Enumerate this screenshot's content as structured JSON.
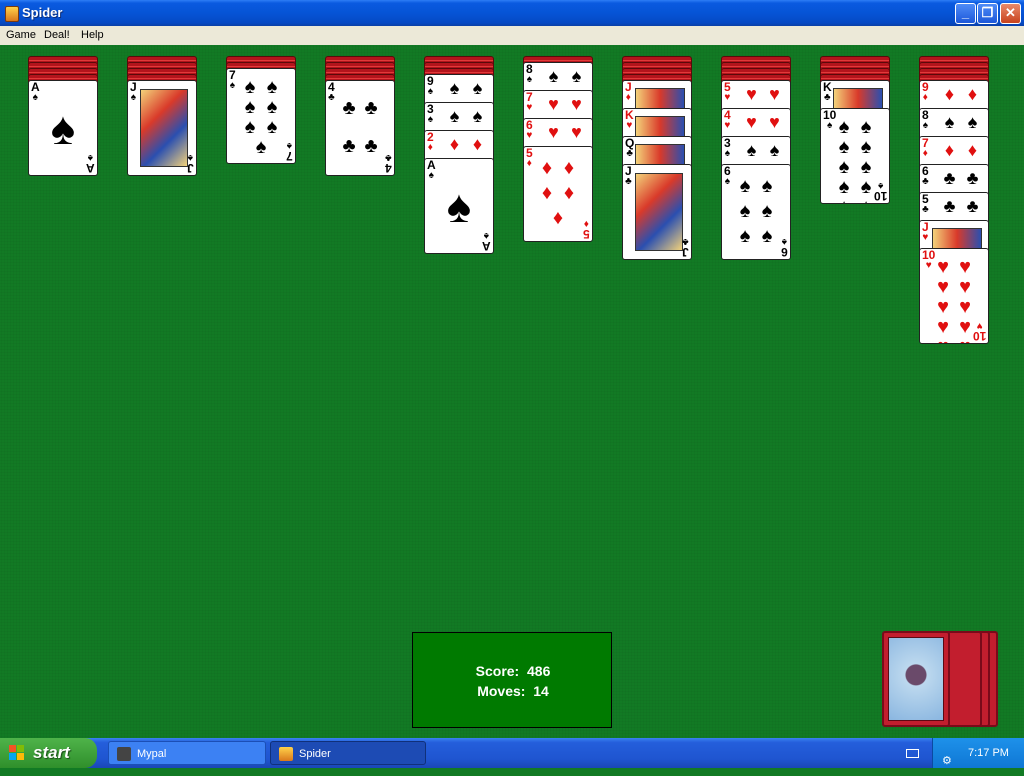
{
  "window": {
    "title": "Spider"
  },
  "menu": [
    "Game",
    "Deal!",
    "Help"
  ],
  "colors": {
    "felt": "#127a24",
    "red_suit": "#e01010",
    "black_suit": "#000000",
    "card_back": "#b3141c"
  },
  "tableau": [
    {
      "column": 1,
      "facedown": 4,
      "faceup": [
        {
          "rank": "A",
          "suit": "♠",
          "color": "black"
        }
      ]
    },
    {
      "column": 2,
      "facedown": 4,
      "faceup": [
        {
          "rank": "J",
          "suit": "♠",
          "color": "black"
        }
      ]
    },
    {
      "column": 3,
      "facedown": 2,
      "faceup": [
        {
          "rank": "7",
          "suit": "♠",
          "color": "black"
        }
      ]
    },
    {
      "column": 4,
      "facedown": 4,
      "faceup": [
        {
          "rank": "4",
          "suit": "♣",
          "color": "black"
        }
      ]
    },
    {
      "column": 5,
      "facedown": 3,
      "faceup": [
        {
          "rank": "9",
          "suit": "♠",
          "color": "black"
        },
        {
          "rank": "3",
          "suit": "♠",
          "color": "black"
        },
        {
          "rank": "2",
          "suit": "♦",
          "color": "red"
        },
        {
          "rank": "A",
          "suit": "♠",
          "color": "black"
        }
      ]
    },
    {
      "column": 6,
      "facedown": 1,
      "faceup": [
        {
          "rank": "8",
          "suit": "♠",
          "color": "black"
        },
        {
          "rank": "7",
          "suit": "♥",
          "color": "red"
        },
        {
          "rank": "6",
          "suit": "♥",
          "color": "red"
        },
        {
          "rank": "5",
          "suit": "♦",
          "color": "red"
        }
      ]
    },
    {
      "column": 7,
      "facedown": 4,
      "faceup": [
        {
          "rank": "J",
          "suit": "♦",
          "color": "red"
        },
        {
          "rank": "K",
          "suit": "♥",
          "color": "red"
        },
        {
          "rank": "Q",
          "suit": "♣",
          "color": "black"
        },
        {
          "rank": "J",
          "suit": "♣",
          "color": "black"
        }
      ]
    },
    {
      "column": 8,
      "facedown": 4,
      "faceup": [
        {
          "rank": "5",
          "suit": "♥",
          "color": "red"
        },
        {
          "rank": "4",
          "suit": "♥",
          "color": "red"
        },
        {
          "rank": "3",
          "suit": "♠",
          "color": "black"
        },
        {
          "rank": "6",
          "suit": "♠",
          "color": "black"
        }
      ]
    },
    {
      "column": 9,
      "facedown": 4,
      "faceup": [
        {
          "rank": "K",
          "suit": "♣",
          "color": "black"
        },
        {
          "rank": "10",
          "suit": "♠",
          "color": "black"
        }
      ]
    },
    {
      "column": 10,
      "facedown": 4,
      "faceup": [
        {
          "rank": "9",
          "suit": "♦",
          "color": "red"
        },
        {
          "rank": "8",
          "suit": "♠",
          "color": "black"
        },
        {
          "rank": "7",
          "suit": "♦",
          "color": "red"
        },
        {
          "rank": "6",
          "suit": "♣",
          "color": "black"
        },
        {
          "rank": "5",
          "suit": "♣",
          "color": "black"
        },
        {
          "rank": "J",
          "suit": "♥",
          "color": "red"
        },
        {
          "rank": "10",
          "suit": "♥",
          "color": "red"
        }
      ]
    }
  ],
  "status": {
    "score_label": "Score:",
    "score": "486",
    "moves_label": "Moves:",
    "moves": "14"
  },
  "stock": {
    "piles": 4
  },
  "taskbar": {
    "start_label": "start",
    "tasks": [
      {
        "label": "Mypal",
        "active": false
      },
      {
        "label": "Spider",
        "active": true
      }
    ],
    "clock": "7:17 PM"
  }
}
